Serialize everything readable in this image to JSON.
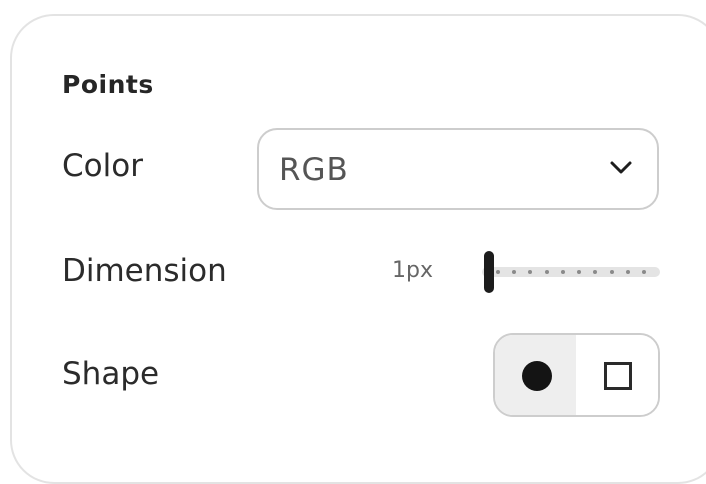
{
  "panel": {
    "section_title": "Points"
  },
  "color": {
    "label": "Color",
    "selected": "RGB"
  },
  "dimension": {
    "label": "Dimension",
    "value_label": "1px",
    "slider_fraction": 0.0
  },
  "shape": {
    "label": "Shape",
    "options": [
      "circle",
      "square"
    ],
    "selected": "circle"
  },
  "icons": {
    "dropdown": "chevron-down-icon",
    "circle": "circle-icon",
    "square": "square-icon"
  }
}
